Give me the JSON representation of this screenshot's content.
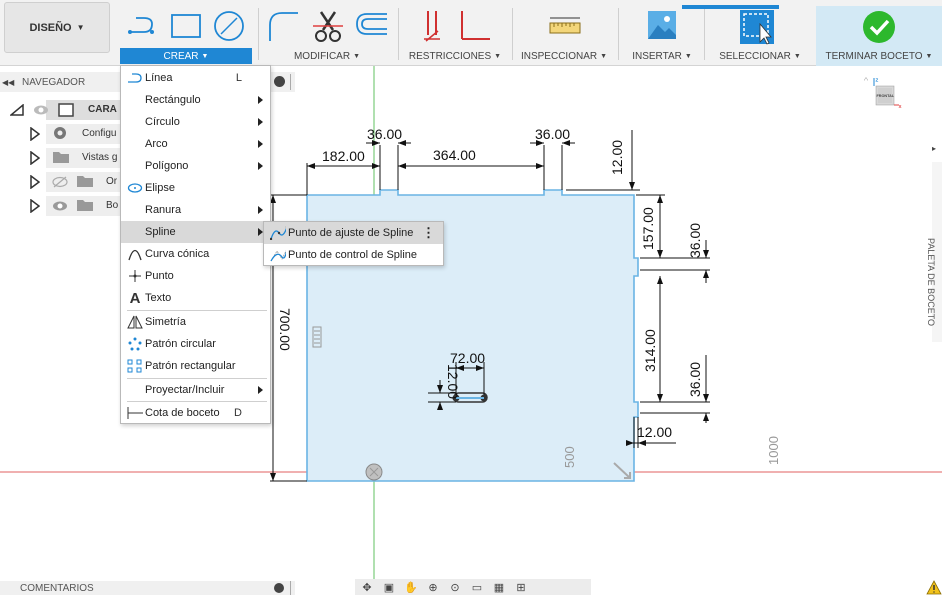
{
  "toolbar": {
    "design_label": "DISEÑO",
    "create_label": "CREAR",
    "modify_label": "MODIFICAR",
    "constraints_label": "RESTRICCIONES",
    "inspect_label": "INSPECCIONAR",
    "insert_label": "INSERTAR",
    "select_label": "SELECCIONAR",
    "finish_label": "TERMINAR BOCETO",
    "icons": [
      "line-icon",
      "rectangle-icon",
      "circle-icon",
      "fillet-icon",
      "trim-icon",
      "offset-icon",
      "restrictions-icon",
      "measure-icon",
      "insert-image-icon",
      "select-icon",
      "finish-check-icon"
    ]
  },
  "navigator": {
    "title": "NAVEGADOR",
    "items": [
      {
        "label": "CARA",
        "icon": "component-icon"
      },
      {
        "label": "Configu",
        "icon": "gear-icon"
      },
      {
        "label": "Vistas g",
        "icon": "folder-icon"
      },
      {
        "label": "Or",
        "icon": "folder-icon"
      },
      {
        "label": "Bo",
        "icon": "folder-icon"
      }
    ]
  },
  "create_menu": {
    "items": [
      {
        "label": "Línea",
        "shortcut": "L",
        "icon": "line-icon"
      },
      {
        "label": "Rectángulo",
        "icon": "rectangle-icon"
      },
      {
        "label": "Círculo",
        "icon": "circle-icon"
      },
      {
        "label": "Arco",
        "icon": "arc-icon"
      },
      {
        "label": "Polígono",
        "icon": "polygon-icon"
      },
      {
        "label": "Elipse",
        "icon": "ellipse-icon"
      },
      {
        "label": "Ranura",
        "icon": "slot-icon"
      },
      {
        "label": "Spline",
        "icon": "spline-icon"
      },
      {
        "label": "Curva cónica",
        "icon": "conic-icon"
      },
      {
        "label": "Punto",
        "icon": "point-icon"
      },
      {
        "label": "Texto",
        "icon": "text-icon"
      },
      {
        "label": "Simetría",
        "icon": "mirror-icon"
      },
      {
        "label": "Patrón circular",
        "icon": "circular-pattern-icon"
      },
      {
        "label": "Patrón rectangular",
        "icon": "rectangular-pattern-icon"
      },
      {
        "label": "Proyectar/Incluir",
        "icon": ""
      },
      {
        "label": "Cota de boceto",
        "shortcut": "D",
        "icon": "dimension-icon"
      }
    ]
  },
  "spline_submenu": {
    "items": [
      {
        "label": "Punto de ajuste de Spline",
        "icon": "fit-point-spline-icon"
      },
      {
        "label": "Punto de control de Spline",
        "icon": "control-point-spline-icon"
      }
    ]
  },
  "dimensions": {
    "top_left": "182.00",
    "notch_left": "36.00",
    "top_middle": "364.00",
    "notch_right": "36.00",
    "right_top": "12.00",
    "right_157": "157.00",
    "right_36a": "36.00",
    "right_314": "314.00",
    "right_36b": "36.00",
    "right_bottom": "12.00",
    "height": "700.00",
    "slot_width": "72.00",
    "slot_height": "12.00",
    "axis_500": "500",
    "axis_1000": "1000"
  },
  "viewcube": {
    "face_label": "FRONTAL",
    "z_label": "Z",
    "x_label": "X"
  },
  "palette": {
    "label": "PALETA DE BOCETO"
  },
  "bottom": {
    "comments_label": "COMENTARIOS"
  },
  "colors": {
    "accent": "#1f87d4",
    "sketch_fill": "#d6ebf7",
    "sketch_line": "#5fb1e2",
    "axis_red": "#e04040",
    "axis_green": "#50c050",
    "finish_bg": "#d3e9f5",
    "finish_check": "#2db82d"
  }
}
